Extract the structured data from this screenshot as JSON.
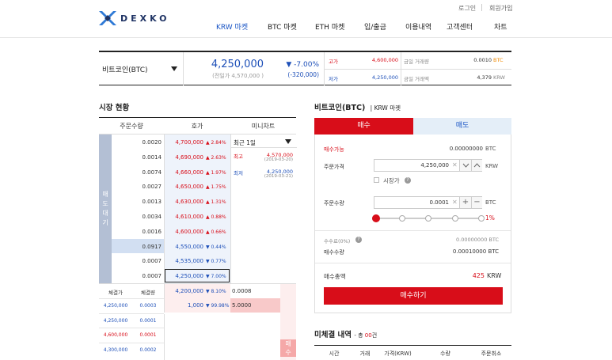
{
  "header": {
    "logo": "DEXKO",
    "top_links": [
      "로그인",
      "회원가입"
    ],
    "nav": [
      "KRW 마켓",
      "BTC 마켓",
      "ETH 마켓",
      "입/출금",
      "이용내역",
      "고객센터",
      "차트"
    ],
    "active_nav": "KRW 마켓",
    "brand_color": "#1f3364",
    "accent_color": "#1a55c5"
  },
  "ticker": {
    "coin": "비트코인(BTC)",
    "price": "4,250,000",
    "prev_close": "(전일가 4,570,000 )",
    "change_pct": "▼ -7.00%",
    "change_abs": "(-320,000)",
    "high_label": "고가",
    "high_value": "4,600,000",
    "low_label": "저가",
    "low_value": "4,250,000",
    "vol_label1": "금일 거래량",
    "vol_value1": "0.0010",
    "vol_unit1": "BTC",
    "vol_label2": "금일 거래액",
    "vol_value2": "4,379",
    "vol_unit2": "KRW"
  },
  "market": {
    "title": "시장 현황",
    "col_headers": [
      "주문수량",
      "호가",
      "미니차트"
    ],
    "sell_label": [
      "매",
      "도",
      "대",
      "기"
    ],
    "buy_label": [
      "매",
      "수"
    ],
    "asks": [
      {
        "qty": "0.0020",
        "price": "4,700,000",
        "pct": "▲ 2.84%"
      },
      {
        "qty": "0.0014",
        "price": "4,690,000",
        "pct": "▲ 2.63%"
      },
      {
        "qty": "0.0074",
        "price": "4,660,000",
        "pct": "▲ 1.97%"
      },
      {
        "qty": "0.0027",
        "price": "4,650,000",
        "pct": "▲ 1.75%"
      },
      {
        "qty": "0.0013",
        "price": "4,630,000",
        "pct": "▲ 1.31%"
      },
      {
        "qty": "0.0034",
        "price": "4,610,000",
        "pct": "▲ 0.88%"
      },
      {
        "qty": "0.0016",
        "price": "4,600,000",
        "pct": "▲ 0.66%"
      },
      {
        "qty": "0.0917",
        "price": "4,550,000",
        "pct": "▼ 0.44%"
      },
      {
        "qty": "0.0007",
        "price": "4,535,000",
        "pct": "▼ 0.77%"
      },
      {
        "qty": "0.0007",
        "price": "4,250,000",
        "pct": "▼ 7.00%"
      }
    ],
    "bids": [
      {
        "price": "4,200,000",
        "pct": "▼ 8.10%",
        "qty": "0.0008"
      },
      {
        "price": "1,000",
        "pct": "▼ 99.98%",
        "qty": "5.0000"
      }
    ],
    "trade_headers": [
      "체결가",
      "체결량"
    ],
    "trades": [
      {
        "price": "4,250,000",
        "qty": "0.0003",
        "color": "blue"
      },
      {
        "price": "4,250,000",
        "qty": "0.0001",
        "color": "blue"
      },
      {
        "price": "4,600,000",
        "qty": "0.0001",
        "color": "red"
      },
      {
        "price": "4,300,000",
        "qty": "0.0002",
        "color": "blue"
      }
    ],
    "mini": {
      "period": "최근 1일",
      "high_label": "최고",
      "high_value": "4,570,000",
      "high_date": "(2019-03-20)",
      "low_label": "최저",
      "low_value": "4,250,000",
      "low_date": "(2019-03-21)"
    }
  },
  "order": {
    "title": "비트코인(BTC)",
    "subtitle": "| KRW 마켓",
    "tab_buy": "매수",
    "tab_sell": "매도",
    "avail_label": "매수가능",
    "avail_value": "0.00000000",
    "avail_unit": "BTC",
    "price_label": "주문가격",
    "price_value": "4,250,000",
    "price_unit": "KRW",
    "market_label": "시장가",
    "qty_label": "주문수량",
    "qty_value": "0.0001",
    "qty_unit": "BTC",
    "slider_pct": "1%",
    "slider_fraction": 0.01,
    "fee_label": "수수료(0%)",
    "fee_value": "0.00000000 BTC",
    "amount_label": "매수수량",
    "amount_value": "0.00010000 BTC",
    "total_label": "매수총액",
    "total_value": "425",
    "total_unit": "KRW",
    "submit": "매수하기",
    "buy_color": "#d80d19"
  },
  "pending": {
    "title": "미체결 내역",
    "count_prefix": "- 총",
    "count": "00",
    "count_suffix": "건",
    "headers": [
      "시간",
      "거래",
      "가격(KRW)",
      "수량",
      "주문취소"
    ]
  }
}
